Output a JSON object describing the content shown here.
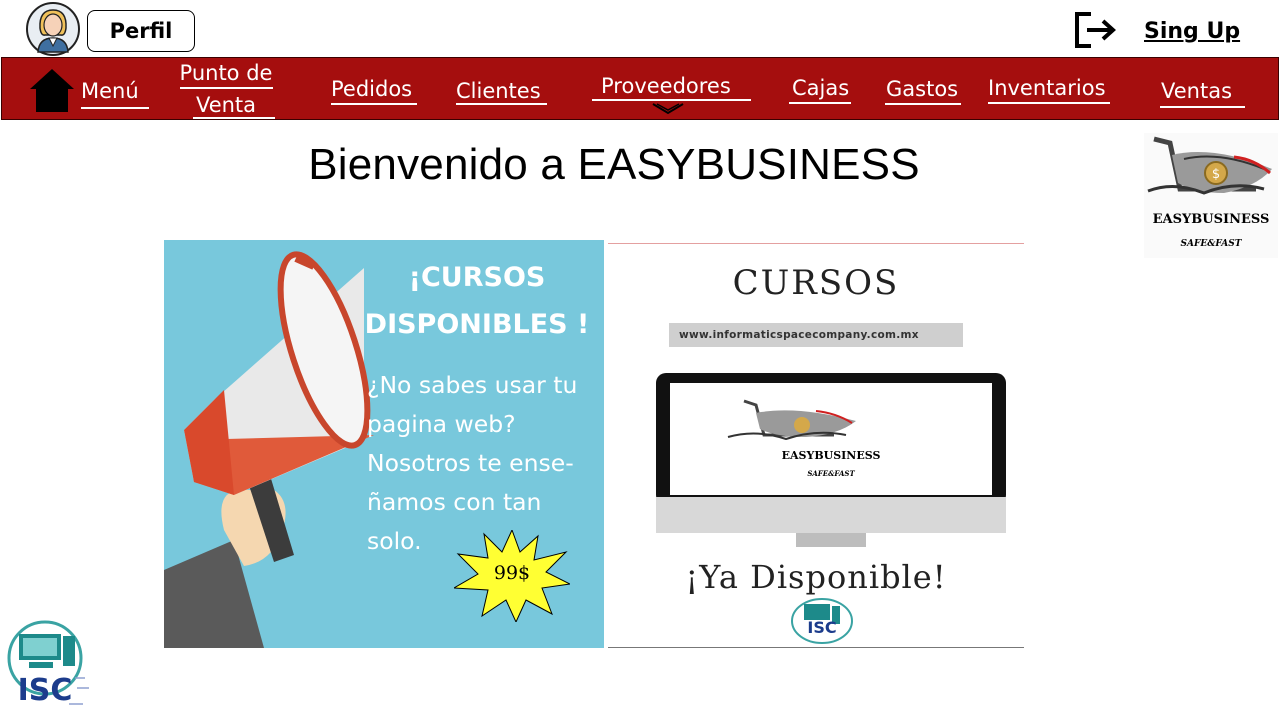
{
  "header": {
    "profile_label": "Perfil",
    "signup_label": "Sing Up",
    "icons": {
      "avatar": "user-avatar-icon",
      "logout": "logout-icon"
    }
  },
  "nav": {
    "items": [
      {
        "label": "Menú"
      },
      {
        "label_line1": "Punto de",
        "label_line2": "Venta"
      },
      {
        "label": "Pedidos"
      },
      {
        "label": "Clientes"
      },
      {
        "label": "Proveedores"
      },
      {
        "label": "Cajas"
      },
      {
        "label": "Gastos"
      },
      {
        "label": "Inventarios"
      },
      {
        "label": "Ventas"
      }
    ],
    "icons": {
      "home": "home-icon",
      "dropdown": "chevron-down-icon"
    },
    "background": "#a50e0e"
  },
  "main": {
    "title": "Bienvenido a EASYBUSINESS"
  },
  "brand": {
    "name": "EASYBUSINESS",
    "tagline": "SAFE&FAST"
  },
  "promo": {
    "title_line1": "¡CURSOS",
    "title_line2": "DISPONIBLES !",
    "body_lines": [
      "¿No sabes usar tu",
      "pagina web?",
      "Nosotros te ense-",
      "ñamos con tan",
      "solo."
    ],
    "price": "99$",
    "background": "#78c8dc"
  },
  "ad": {
    "title": "CURSOS",
    "url": "www.informaticspacecompany.com.mx",
    "screen_brand": "EASYBUSINESS",
    "screen_tagline": "SAFE&FAST",
    "available": "¡Ya Disponible!",
    "isc_label": "ISC"
  },
  "footer": {
    "isc_label": "ISC"
  }
}
